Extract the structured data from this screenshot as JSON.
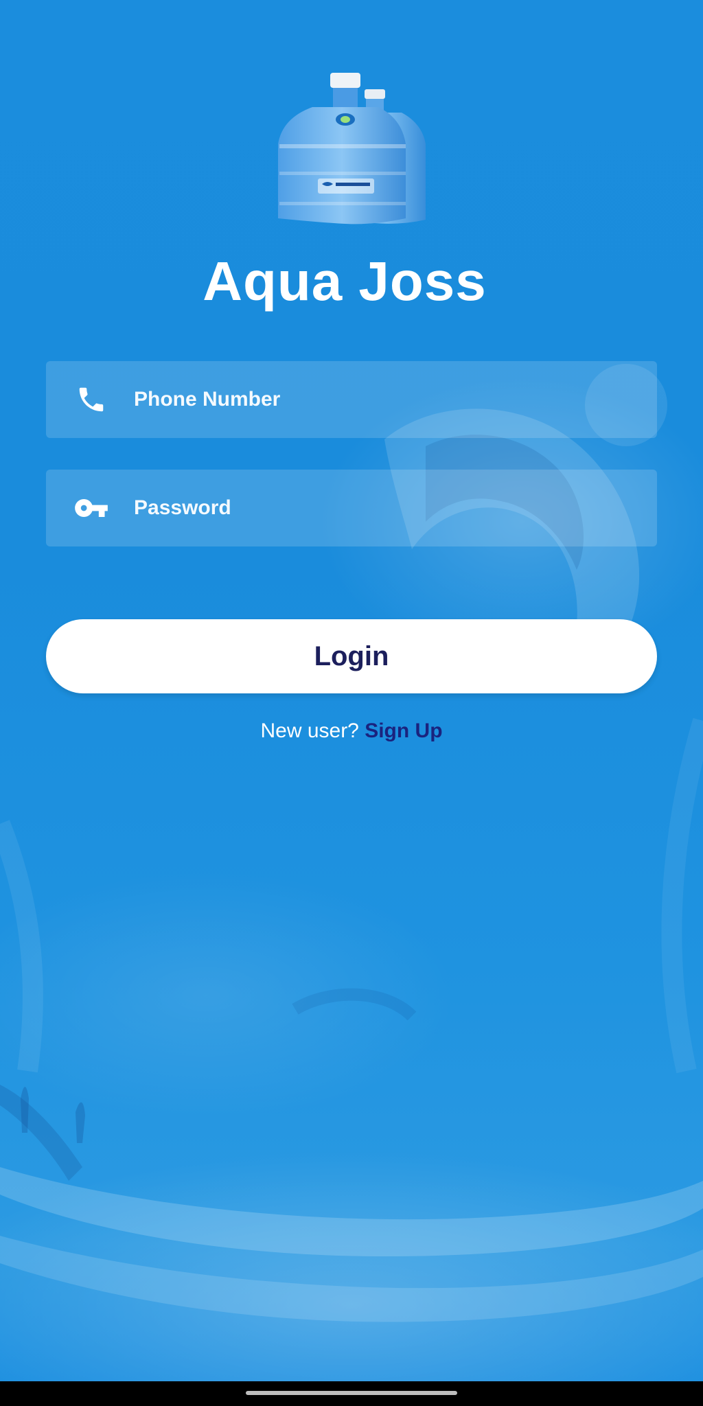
{
  "app": {
    "title": "Aqua Joss",
    "logo_icon": "water-bottle-icon",
    "background_color": "#1e90e0"
  },
  "form": {
    "phone": {
      "icon": "phone-icon",
      "placeholder": "Phone Number",
      "value": ""
    },
    "password": {
      "icon": "key-icon",
      "placeholder": "Password",
      "value": ""
    },
    "login_label": "Login",
    "login_text_color": "#1c1f5c"
  },
  "signup": {
    "prompt": "New user?",
    "link_label": "Sign Up",
    "link_color": "#1a237e"
  }
}
